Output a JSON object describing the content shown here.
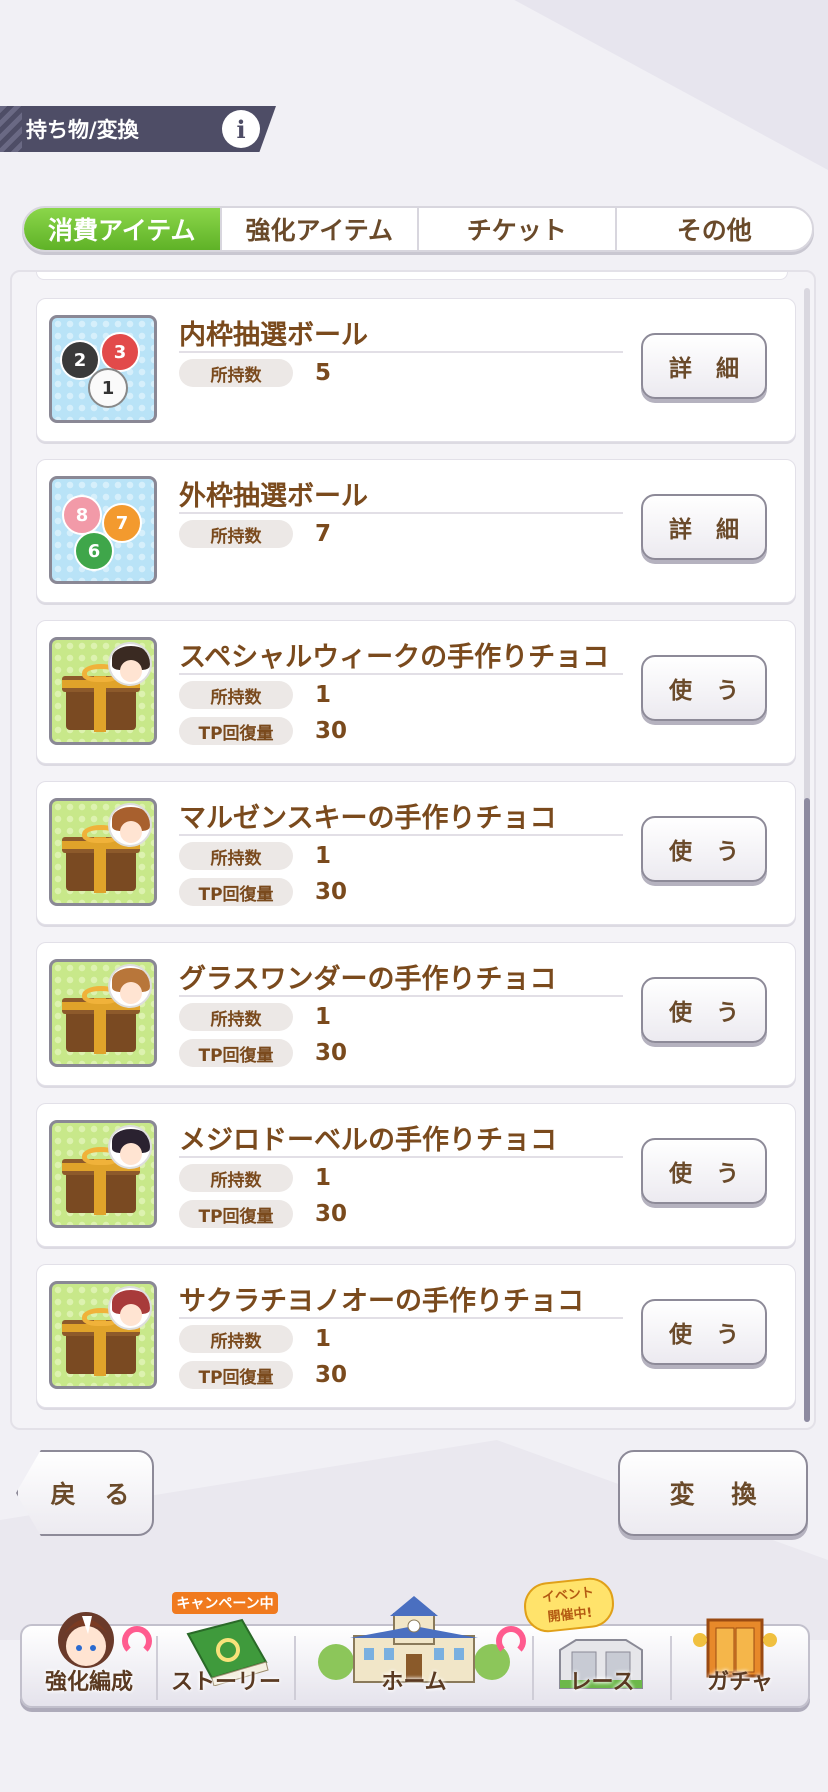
{
  "header": {
    "title": "持ち物/変換",
    "info_label": "i"
  },
  "tabs": [
    {
      "label": "消費アイテム",
      "active": true
    },
    {
      "label": "強化アイテム",
      "active": false
    },
    {
      "label": "チケット",
      "active": false
    },
    {
      "label": "その他",
      "active": false
    }
  ],
  "items": [
    {
      "name": "内枠抽選ボール",
      "owned_label": "所持数",
      "owned": "5",
      "button": "詳 細",
      "icon": "inner-lottery-balls-icon"
    },
    {
      "name": "外枠抽選ボール",
      "owned_label": "所持数",
      "owned": "7",
      "button": "詳 細",
      "icon": "outer-lottery-balls-icon"
    },
    {
      "name": "スペシャルウィークの手作りチョコ",
      "owned_label": "所持数",
      "owned": "1",
      "tp_label": "TP回復量",
      "tp": "30",
      "button": "使 う",
      "icon": "chocolate-gift-icon"
    },
    {
      "name": "マルゼンスキーの手作りチョコ",
      "owned_label": "所持数",
      "owned": "1",
      "tp_label": "TP回復量",
      "tp": "30",
      "button": "使 う",
      "icon": "chocolate-gift-icon"
    },
    {
      "name": "グラスワンダーの手作りチョコ",
      "owned_label": "所持数",
      "owned": "1",
      "tp_label": "TP回復量",
      "tp": "30",
      "button": "使 う",
      "icon": "chocolate-gift-icon"
    },
    {
      "name": "メジロドーベルの手作りチョコ",
      "owned_label": "所持数",
      "owned": "1",
      "tp_label": "TP回復量",
      "tp": "30",
      "button": "使 う",
      "icon": "chocolate-gift-icon"
    },
    {
      "name": "サクラチヨノオーの手作りチョコ",
      "owned_label": "所持数",
      "owned": "1",
      "tp_label": "TP回復量",
      "tp": "30",
      "button": "使 う",
      "icon": "chocolate-gift-icon"
    }
  ],
  "balls": {
    "inner": [
      "2",
      "3",
      "1"
    ],
    "outer": [
      "8",
      "7",
      "6"
    ]
  },
  "actions": {
    "back": "戻 る",
    "convert": "変 換"
  },
  "nav": {
    "items": [
      {
        "label": "強化編成",
        "icon": "character-portrait-icon"
      },
      {
        "label": "ストーリー",
        "icon": "story-book-icon"
      },
      {
        "label": "ホーム",
        "icon": "school-building-icon"
      },
      {
        "label": "レース",
        "icon": "race-gate-icon"
      },
      {
        "label": "ガチャ",
        "icon": "gacha-gate-icon"
      }
    ],
    "campaign_badge": "キャンペーン中",
    "event_badge_line1": "イベント",
    "event_badge_line2": "開催中!"
  },
  "colors": {
    "tab_active": "#6cc034",
    "text_brown": "#7a4a1d",
    "header_bg": "#4e4d66",
    "notify": "#ff5b8f"
  }
}
